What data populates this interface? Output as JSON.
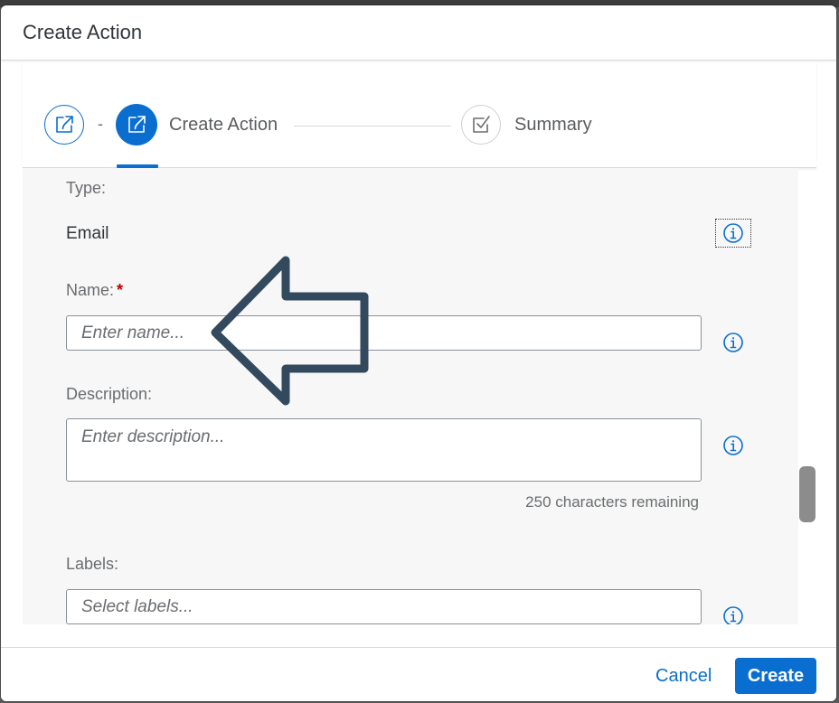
{
  "dialog": {
    "title": "Create Action"
  },
  "wizard": {
    "separator": "-",
    "steps": [
      {
        "label": "",
        "icon": "share-icon",
        "state": "completed"
      },
      {
        "label": "Create Action",
        "icon": "share-icon",
        "state": "current"
      },
      {
        "label": "Summary",
        "icon": "checkbox-icon",
        "state": "upcoming"
      }
    ]
  },
  "form": {
    "type": {
      "label": "Type:",
      "value": "Email"
    },
    "name": {
      "label": "Name:",
      "required_marker": "*",
      "placeholder": "Enter name...",
      "value": ""
    },
    "description": {
      "label": "Description:",
      "placeholder": "Enter description...",
      "value": "",
      "counter": "250 characters remaining"
    },
    "labels": {
      "label": "Labels:",
      "placeholder": "Select labels...",
      "value": ""
    }
  },
  "footer": {
    "cancel_label": "Cancel",
    "create_label": "Create"
  },
  "colors": {
    "accent": "#0a6ed1",
    "required": "#bb0000",
    "arrow": "#334a5e"
  }
}
